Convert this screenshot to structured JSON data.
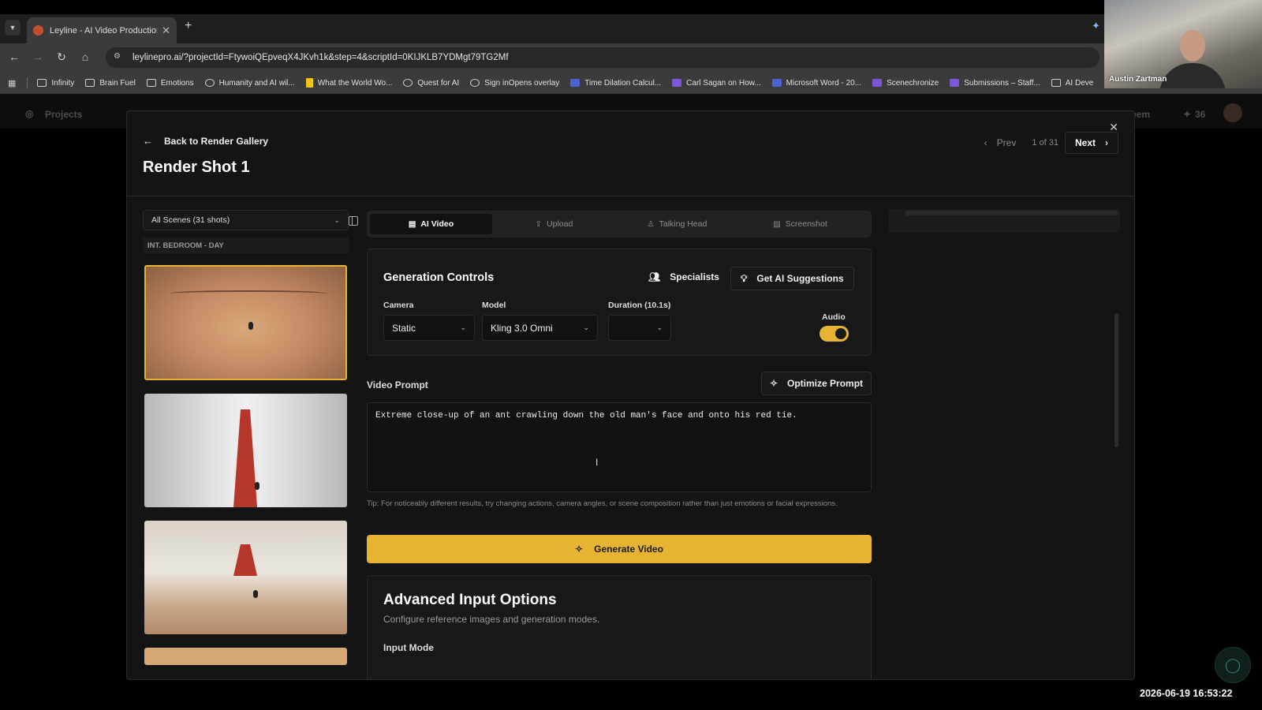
{
  "browser": {
    "tab_title": "Leyline - AI Video Production Pl",
    "url": "leylinepro.ai/?projectId=FtywoiQEpveqX4JKvh1k&step=4&scriptId=0KIJKLB7YDMgt79TG2Mf",
    "bookmarks": [
      {
        "label": "Infinity",
        "icon": "folder-icon"
      },
      {
        "label": "Brain Fuel",
        "icon": "folder-icon"
      },
      {
        "label": "Emotions",
        "icon": "folder-icon"
      },
      {
        "label": "Humanity and AI wil...",
        "icon": "globe-icon"
      },
      {
        "label": "What the World Wo...",
        "icon": "doc-icon"
      },
      {
        "label": "Quest for AI",
        "icon": "globe-icon"
      },
      {
        "label": "Sign inOpens overlay",
        "icon": "globe-icon"
      },
      {
        "label": "Time Dilation Calcul...",
        "icon": "e-icon"
      },
      {
        "label": "Carl Sagan on How...",
        "icon": "site-icon"
      },
      {
        "label": "Microsoft Word - 20...",
        "icon": "word-icon"
      },
      {
        "label": "Scenechronize",
        "icon": "site-icon"
      },
      {
        "label": "Submissions – Staff...",
        "icon": "site-icon"
      },
      {
        "label": "AI Deve",
        "icon": "folder-icon"
      }
    ]
  },
  "webcam": {
    "name": "Austin Zartman"
  },
  "background_app": {
    "nav_projects": "Projects",
    "right_label": "eem",
    "count": "36"
  },
  "modal": {
    "back_label": "Back to Render Gallery",
    "title": "Render Shot 1",
    "pager": {
      "prev": "Prev",
      "count": "1 of 31",
      "next": "Next"
    },
    "scene_select": "All Scenes (31 shots)",
    "scene_header": "INT. BEDROOM - DAY",
    "tabs": [
      {
        "label": "AI Video",
        "icon": "film-icon"
      },
      {
        "label": "Upload",
        "icon": "upload-icon"
      },
      {
        "label": "Talking Head",
        "icon": "person-icon"
      },
      {
        "label": "Screenshot",
        "icon": "image-icon"
      }
    ],
    "generation": {
      "title": "Generation Controls",
      "specialists": "Specialists",
      "suggestions": "Get AI Suggestions",
      "camera_label": "Camera",
      "camera_value": "Static",
      "model_label": "Model",
      "model_value": "Kling 3.0 Omni",
      "duration_label": "Duration (10.1s)",
      "duration_value": "",
      "audio_label": "Audio",
      "audio_on": true
    },
    "video_prompt_label": "Video Prompt",
    "optimize_label": "Optimize Prompt",
    "prompt_text": "Extreme close-up of an ant crawling down the old man's face and onto his red tie.",
    "tip": "Tip: For noticeably different results, try changing actions, camera angles, or scene composition rather than just emotions or facial expressions.",
    "generate_label": "Generate Video",
    "advanced": {
      "title": "Advanced Input Options",
      "subtitle": "Configure reference images and generation modes.",
      "input_mode": "Input Mode"
    }
  },
  "timestamp": "2026-06-19  16:53:22",
  "colors": {
    "accent": "#e6b432",
    "modal_bg": "#141414"
  }
}
